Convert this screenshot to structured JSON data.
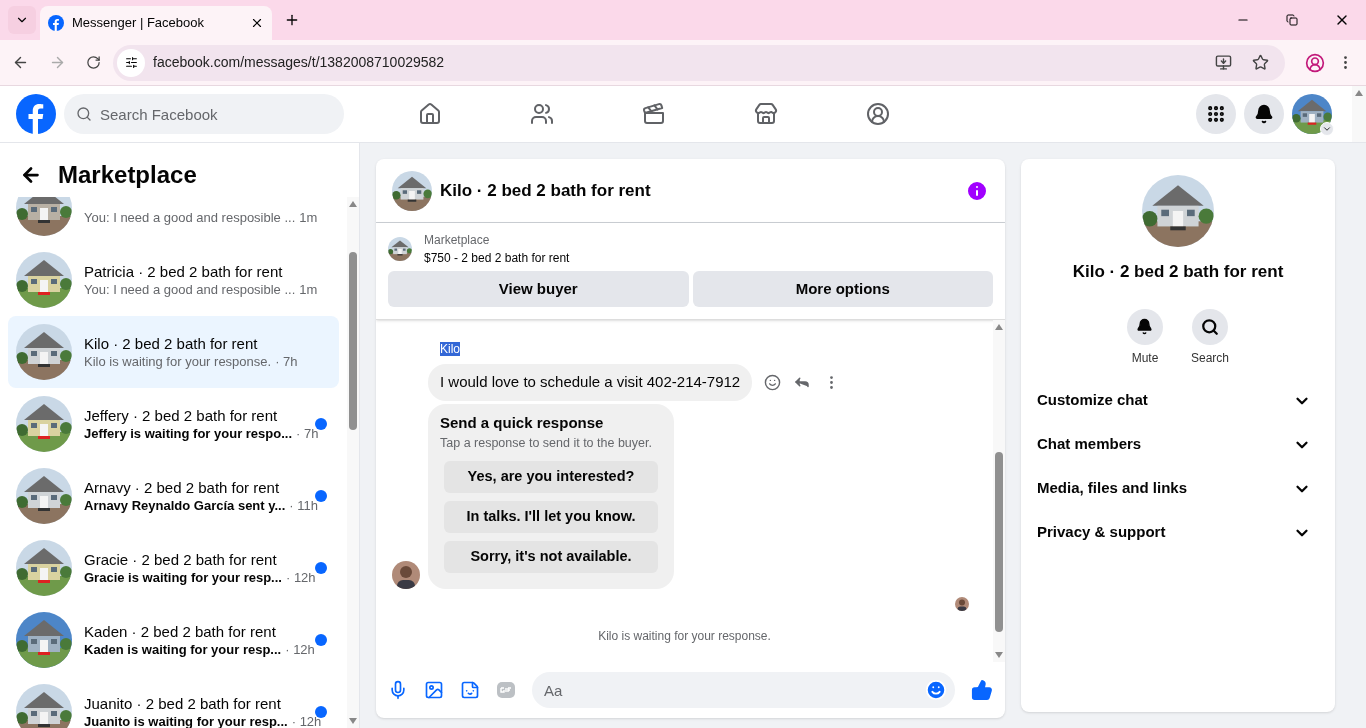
{
  "browser": {
    "tab": {
      "title": "Messenger | Facebook"
    },
    "url": "facebook.com/messages/t/1382008710029582"
  },
  "header": {
    "search": {
      "placeholder": "Search Facebook"
    }
  },
  "sidebar": {
    "title": "Marketplace",
    "conversations": [
      {
        "preview": "You: I need a good and resposible ...",
        "time": "1m",
        "unread": false,
        "selected": false
      },
      {
        "title": "Patricia · 2 bed 2 bath for rent",
        "preview": "You: I need a good and resposible ...",
        "time": "1m",
        "unread": false,
        "selected": false
      },
      {
        "title": "Kilo · 2 bed 2 bath for rent",
        "preview": "Kilo is waiting for your response.",
        "time": "· 7h",
        "unread": false,
        "selected": true
      },
      {
        "title": "Jeffery · 2 bed 2 bath for rent",
        "preview": "Jeffery is waiting for your respo...",
        "time": "· 7h",
        "unread": true,
        "selected": false
      },
      {
        "title": "Arnavy · 2 bed 2 bath for rent",
        "preview": "Arnavy Reynaldo García sent y...",
        "time": "· 11h",
        "unread": true,
        "selected": false
      },
      {
        "title": "Gracie · 2 bed 2 bath for rent",
        "preview": "Gracie is waiting for your resp...",
        "time": "· 12h",
        "unread": true,
        "selected": false
      },
      {
        "title": "Kaden · 2 bed 2 bath for rent",
        "preview": "Kaden is waiting for your resp...",
        "time": "· 12h",
        "unread": true,
        "selected": false
      },
      {
        "title": "Juanito · 2 bed 2 bath for rent",
        "preview": "Juanito is waiting for your resp...",
        "time": "· 12h",
        "unread": true,
        "selected": false
      }
    ]
  },
  "chat": {
    "title": "Kilo · 2 bed 2 bath for rent",
    "listing": {
      "label": "Marketplace",
      "description": "$750 - 2 bed 2 bath for rent"
    },
    "actions": [
      "View buyer",
      "More options"
    ],
    "message": {
      "sender": "Kilo",
      "sender_highlighted": true,
      "text": "I would love to schedule a visit 402-214-7912"
    },
    "quick_response": {
      "title": "Send a quick response",
      "subtitle": "Tap a response to send it to the buyer.",
      "options": [
        "Yes, are you interested?",
        "In talks. I'll let you know.",
        "Sorry, it's not available."
      ]
    },
    "status": "Kilo is waiting for your response.",
    "composer": {
      "placeholder": "Aa"
    }
  },
  "details": {
    "title": "Kilo · 2 bed 2 bath for rent",
    "actions": [
      {
        "kind": "mute",
        "label": "Mute"
      },
      {
        "kind": "search",
        "label": "Search"
      }
    ],
    "sections": [
      {
        "label": "Customize chat",
        "expanded": false
      },
      {
        "label": "Chat members",
        "expanded": false
      },
      {
        "label": "Media, files and links",
        "expanded": false
      },
      {
        "label": "Privacy & support",
        "expanded": false
      }
    ]
  }
}
